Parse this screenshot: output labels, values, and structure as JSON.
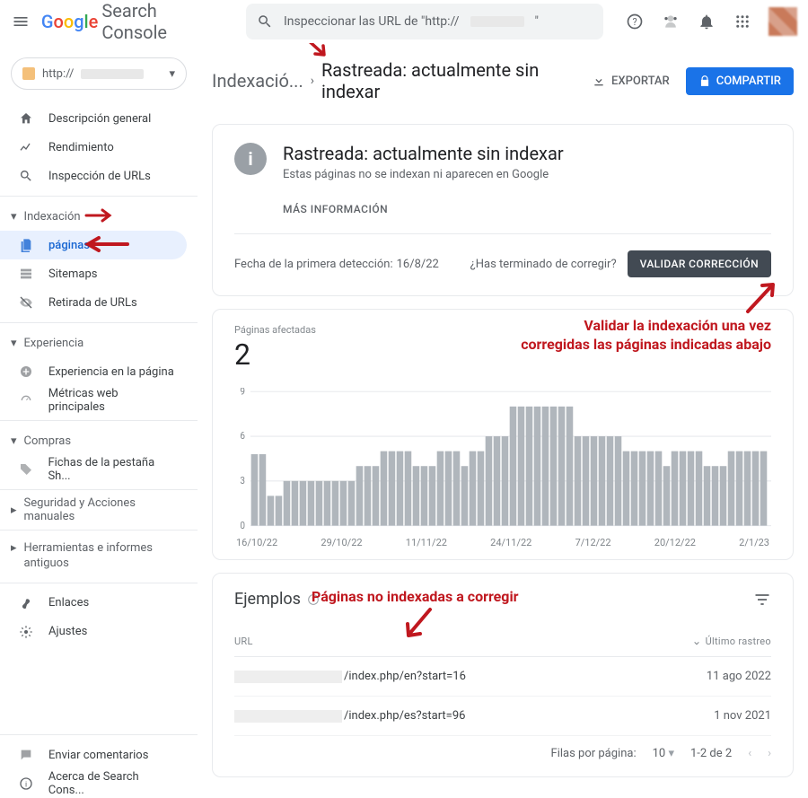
{
  "header": {
    "product": "Search Console",
    "search_placeholder": "Inspeccionar las URL de \"http://",
    "search_suffix": "\"",
    "property_prefix": "http://"
  },
  "sidebar": {
    "items": [
      "Descripción general",
      "Rendimiento",
      "Inspección de URLs"
    ],
    "group_index": "Indexación",
    "index_items": [
      "páginas",
      "Sitemaps",
      "Retirada de URLs"
    ],
    "group_exp": "Experiencia",
    "exp_items": [
      "Experiencia en la página",
      "Métricas web principales"
    ],
    "group_shop": "Compras",
    "shop_items": [
      "Fichas de la pestaña Sh..."
    ],
    "group_sec": "Seguridad y Acciones manuales",
    "group_tools": "Herramientas e informes antiguos",
    "links": "Enlaces",
    "settings": "Ajustes",
    "feedback": "Enviar comentarios",
    "about": "Acerca de Search Cons..."
  },
  "breadcrumb": {
    "root": "Indexació...",
    "current": "Rastreada: actualmente sin indexar",
    "export": "EXPORTAR",
    "share": "COMPARTIR"
  },
  "info": {
    "title": "Rastreada: actualmente sin indexar",
    "sub": "Estas páginas no se indexan ni aparecen en Google",
    "more": "MÁS INFORMACIÓN",
    "first_detect_label": "Fecha de la primera detección:",
    "first_detect_value": "16/8/22",
    "done_q": "¿Has terminado de corregir?",
    "validate": "VALIDAR CORRECCIÓN"
  },
  "annotations": {
    "validate_text_l1": "Validar la indexación una vez",
    "validate_text_l2": "corregidas las páginas indicadas abajo",
    "examples_text": "Páginas no indexadas a corregir"
  },
  "chart_data": {
    "type": "bar",
    "title": "Páginas afectadas",
    "big_value": "2",
    "ylim": [
      0,
      9
    ],
    "y_ticks": [
      0,
      3,
      6,
      9
    ],
    "x_ticks": [
      "16/10/22",
      "29/10/22",
      "11/11/22",
      "24/11/22",
      "7/12/22",
      "20/12/22",
      "2/1/23"
    ],
    "values": [
      4.8,
      4.8,
      2,
      2,
      3,
      3,
      3,
      3,
      3,
      3,
      3,
      3,
      3,
      4,
      4,
      4,
      5,
      5,
      5,
      5,
      4,
      4,
      4,
      5,
      5,
      5,
      4,
      5,
      5,
      6,
      6,
      6,
      8,
      8,
      8,
      8,
      8,
      8,
      8,
      8,
      6,
      6,
      6,
      6,
      6,
      6,
      5,
      5,
      5,
      5,
      5,
      4,
      5,
      5,
      5,
      5,
      4,
      4,
      4,
      5,
      5,
      5,
      5,
      5
    ]
  },
  "examples": {
    "heading": "Ejemplos",
    "col_url": "URL",
    "col_date": "Último rastreo",
    "rows": [
      {
        "path": "/index.php/en?start=16",
        "date": "11 ago 2022"
      },
      {
        "path": "/index.php/es?start=96",
        "date": "1 nov 2021"
      }
    ],
    "pager": {
      "rpp_label": "Filas por página:",
      "rpp": "10",
      "range": "1-2 de 2"
    }
  }
}
